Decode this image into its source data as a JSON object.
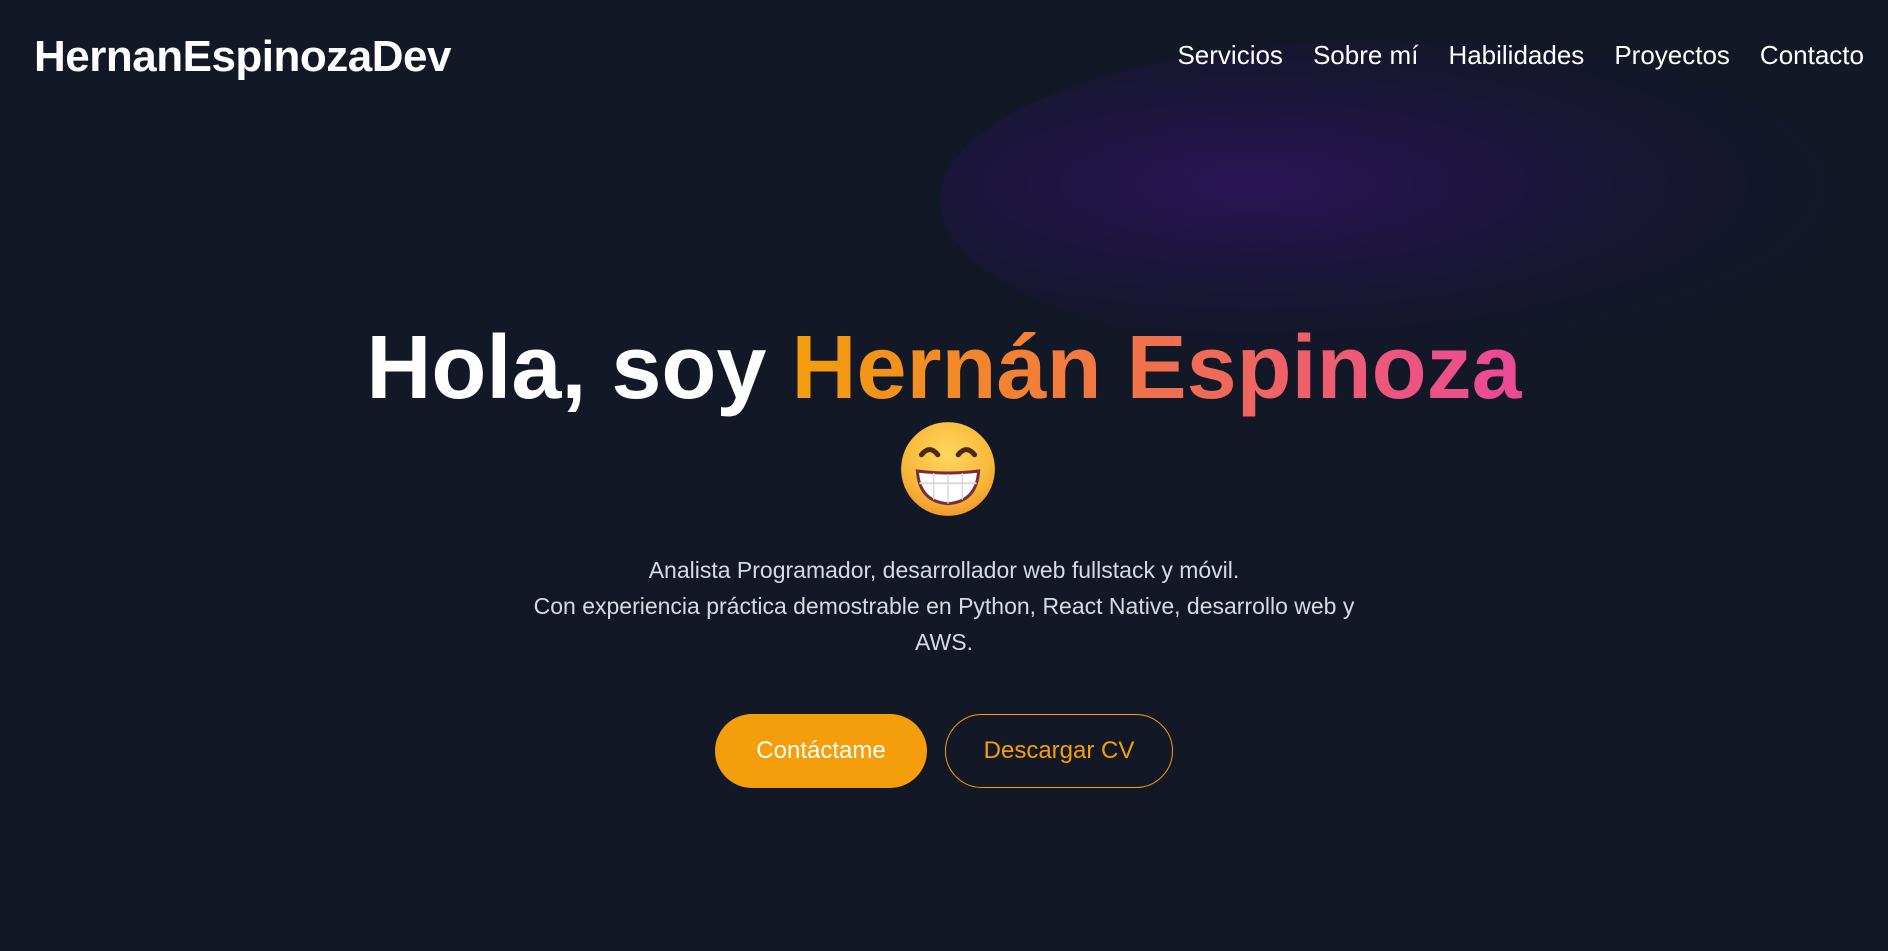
{
  "brand": {
    "logo_text": "HernanEspinozaDev"
  },
  "nav": {
    "items": [
      {
        "label": "Servicios"
      },
      {
        "label": "Sobre mí"
      },
      {
        "label": "Habilidades"
      },
      {
        "label": "Proyectos"
      },
      {
        "label": "Contacto"
      }
    ]
  },
  "hero": {
    "greeting": "Hola, soy ",
    "name": "Hernán Espinoza",
    "emoji_icon": "grinning-face-icon",
    "description_line1": "Analista Programador, desarrollador web fullstack y móvil.",
    "description_line2": "Con experiencia práctica demostrable en Python, React Native, desarrollo web y",
    "description_line3": "AWS.",
    "primary_button": "Contáctame",
    "secondary_button": "Descargar CV"
  },
  "colors": {
    "background": "#121826",
    "accent": "#f59e0b",
    "gradient_end": "#ec4899",
    "glow": "#2e1460"
  }
}
